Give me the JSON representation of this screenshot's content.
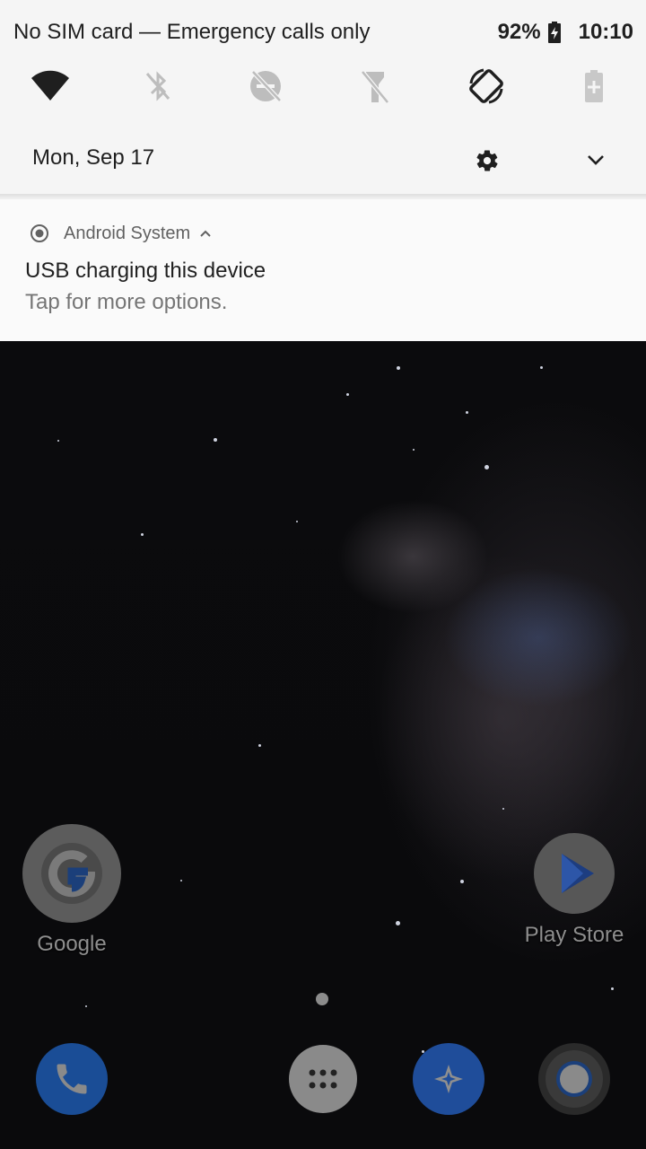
{
  "status_bar": {
    "carrier_text": "No SIM card — Emergency calls only",
    "battery_percent": "92%",
    "time": "10:10"
  },
  "quick_settings": {
    "tiles": [
      {
        "icon": "wifi-icon",
        "state": "on"
      },
      {
        "icon": "bluetooth-off-icon",
        "state": "off"
      },
      {
        "icon": "do-not-disturb-off-icon",
        "state": "off"
      },
      {
        "icon": "flashlight-off-icon",
        "state": "off"
      },
      {
        "icon": "auto-rotate-icon",
        "state": "on"
      },
      {
        "icon": "battery-saver-icon",
        "state": "off"
      }
    ],
    "date": "Mon, Sep 17"
  },
  "notification": {
    "app_name": "Android System",
    "title": "USB charging this device",
    "text": "Tap for more options."
  },
  "home": {
    "apps": [
      {
        "label": "Google",
        "icon": "google-icon"
      },
      {
        "label": "Play Store",
        "icon": "play-store-icon"
      }
    ],
    "dock": [
      {
        "icon": "phone-icon"
      },
      {
        "icon": "app-drawer-icon"
      },
      {
        "icon": "maps-icon"
      },
      {
        "icon": "chrome-icon"
      }
    ]
  },
  "colors": {
    "shade_bg": "#f5f5f5",
    "icon_dark": "#1f1f1f",
    "icon_disabled": "#bdbdbd",
    "dock_phone": "#1e56a8"
  }
}
